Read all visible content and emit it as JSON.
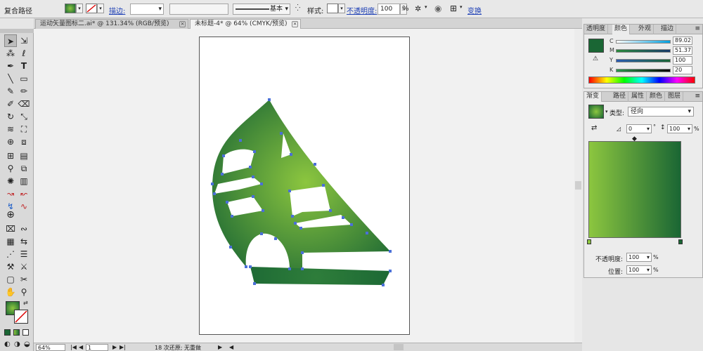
{
  "control_bar": {
    "object_type": "复合路径",
    "stroke_label": "描边:",
    "stroke_profile": "基本",
    "style_label": "样式:",
    "opacity_label": "不透明度:",
    "opacity_value": "100",
    "percent": "%",
    "transform_link": "变换"
  },
  "tabs": [
    {
      "label": "运动矢量图标二.ai* @ 131.34% (RGB/预览)"
    },
    {
      "label": "未标题-4* @ 64% (CMYK/预览)"
    }
  ],
  "color_panel": {
    "tabs": [
      "透明度",
      "颜色",
      "外观",
      "描边"
    ],
    "channels": [
      {
        "name": "C",
        "value": "89.02"
      },
      {
        "name": "M",
        "value": "51.37"
      },
      {
        "name": "Y",
        "value": "100"
      },
      {
        "name": "K",
        "value": "20"
      }
    ]
  },
  "gradient_panel": {
    "tabs": [
      "渐变",
      "路径",
      "属性",
      "颜色",
      "图层"
    ],
    "type_label": "类型:",
    "type_value": "径向",
    "angle_value": "0",
    "aspect_value": "100",
    "percent": "%",
    "opacity_label": "不透明度:",
    "opacity_value": "100",
    "position_label": "位置:",
    "position_value": "100"
  },
  "status_bar": {
    "zoom": "64%",
    "page": "1",
    "status_text": "18 次还原; 无重做"
  },
  "colors": {
    "fill_dark": "#1a6634",
    "fill_light": "#8cc63f",
    "anchor": "#4a6fd8"
  }
}
